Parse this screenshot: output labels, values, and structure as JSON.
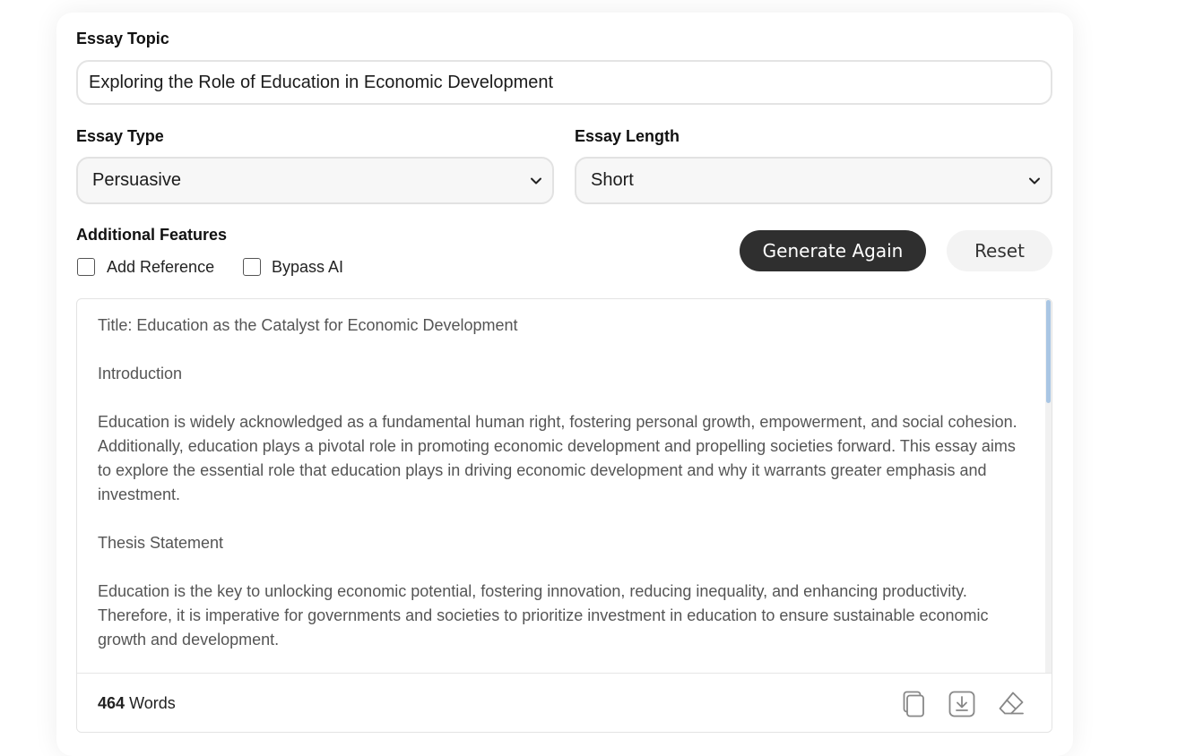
{
  "form": {
    "topic_label": "Essay Topic",
    "topic_value": "Exploring the Role of Education in Economic Development",
    "type_label": "Essay Type",
    "type_value": "Persuasive",
    "length_label": "Essay Length",
    "length_value": "Short",
    "features_label": "Additional Features",
    "features": [
      {
        "label": "Add Reference",
        "checked": false
      },
      {
        "label": "Bypass AI",
        "checked": false
      }
    ],
    "generate_label": "Generate Again",
    "reset_label": "Reset"
  },
  "output": {
    "paragraphs": [
      "Title: Education as the Catalyst for Economic Development",
      "Introduction",
      "Education is widely acknowledged as a fundamental human right, fostering personal growth, empowerment, and social cohesion. Additionally, education plays a pivotal role in promoting economic development and propelling societies forward. This essay aims to explore the essential role that education plays in driving economic development and why it warrants greater emphasis and investment.",
      "Thesis Statement",
      "Education is the key to unlocking economic potential, fostering innovation, reducing inequality, and enhancing productivity. Therefore, it is imperative for governments and societies to prioritize investment in education to ensure sustainable economic growth and development."
    ],
    "word_count": "464",
    "word_unit": "Words",
    "icons": [
      "copy-icon",
      "download-icon",
      "eraser-icon"
    ]
  },
  "colors": {
    "primary_button": "#2f2f2f",
    "scroll_thumb": "#a9c6e4"
  }
}
